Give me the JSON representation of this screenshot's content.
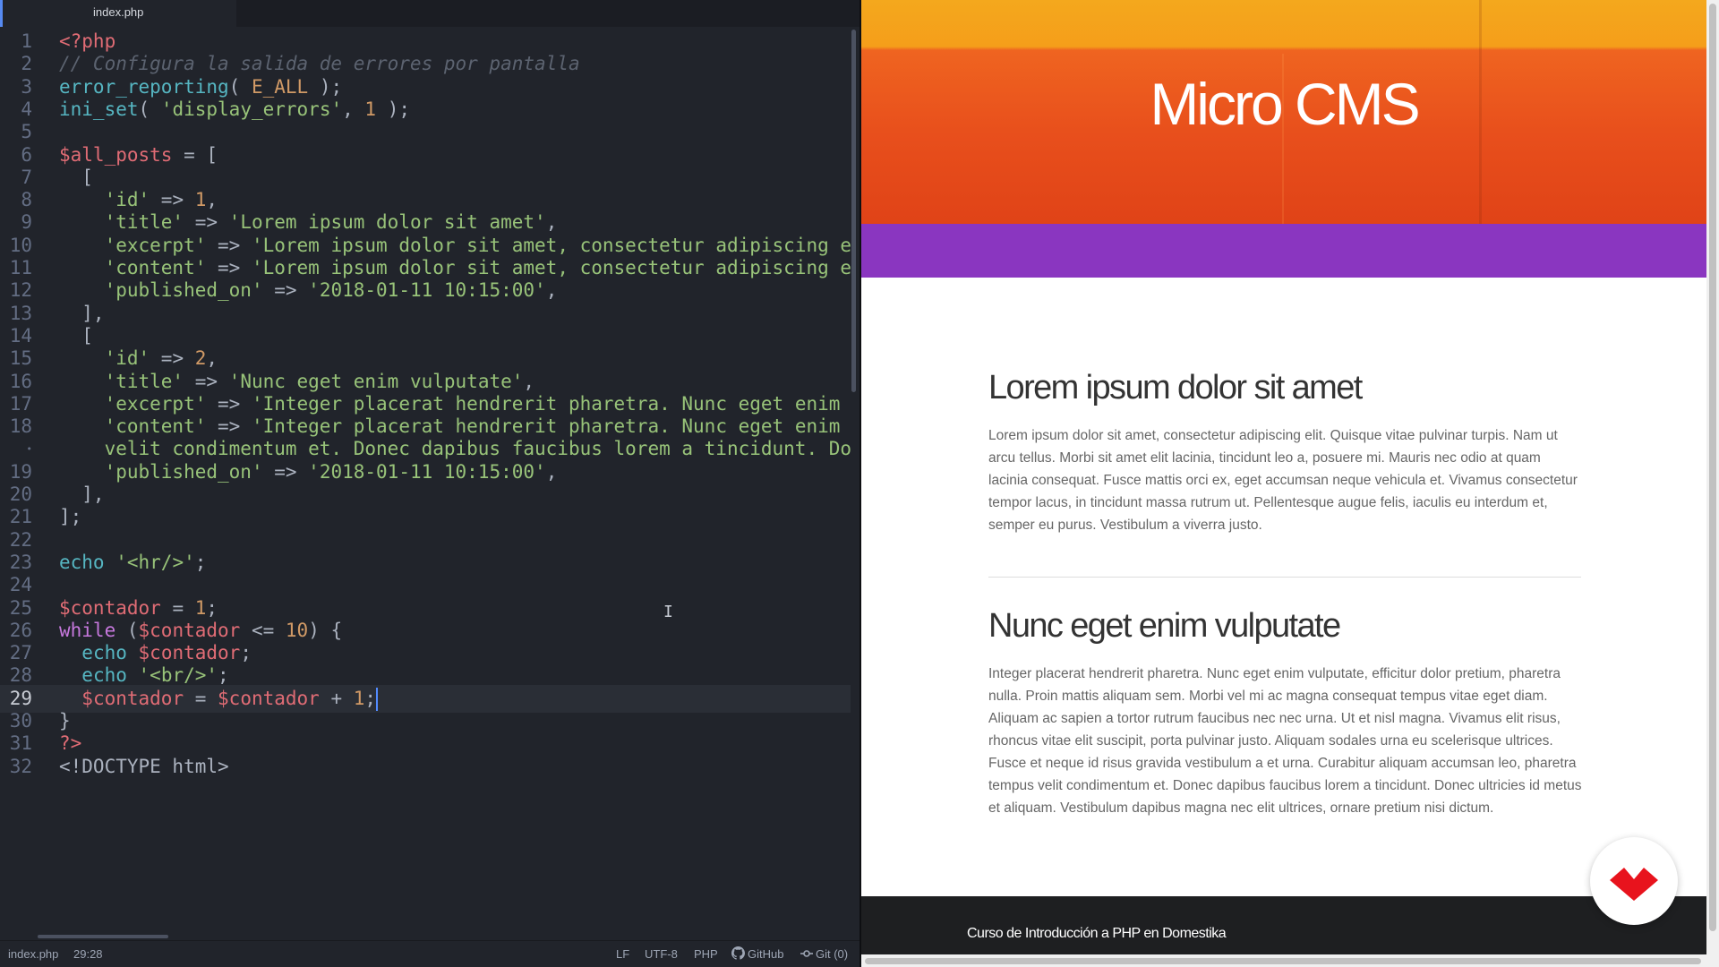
{
  "editor": {
    "tab_label": "index.php",
    "colors": {
      "keyword": "#c678dd",
      "function": "#56b6c2",
      "string": "#98c379",
      "number": "#d19a66",
      "variable": "#e06c75",
      "comment": "#5c6370",
      "punctuation": "#abb2bf"
    },
    "cursor_line": 29,
    "lines": [
      {
        "n": "1",
        "tokens": [
          [
            "<?php",
            "#e06c75"
          ]
        ]
      },
      {
        "n": "2",
        "tokens": [
          [
            "// Configura la salida de errores por pantalla",
            "#5c6370",
            "italic"
          ]
        ]
      },
      {
        "n": "3",
        "tokens": [
          [
            "error_reporting",
            "#56b6c2"
          ],
          [
            "( ",
            "#abb2bf"
          ],
          [
            "E_ALL",
            "#d19a66"
          ],
          [
            " );",
            "#abb2bf"
          ]
        ]
      },
      {
        "n": "4",
        "tokens": [
          [
            "ini_set",
            "#56b6c2"
          ],
          [
            "( ",
            "#abb2bf"
          ],
          [
            "'display_errors'",
            "#98c379"
          ],
          [
            ", ",
            "#abb2bf"
          ],
          [
            "1",
            "#d19a66"
          ],
          [
            " );",
            "#abb2bf"
          ]
        ]
      },
      {
        "n": "5",
        "tokens": []
      },
      {
        "n": "6",
        "tokens": [
          [
            "$all_posts",
            "#e06c75"
          ],
          [
            " = [",
            "#abb2bf"
          ]
        ]
      },
      {
        "n": "7",
        "tokens": [
          [
            "  [",
            "#abb2bf"
          ]
        ]
      },
      {
        "n": "8",
        "tokens": [
          [
            "    ",
            "#abb2bf"
          ],
          [
            "'id'",
            "#98c379"
          ],
          [
            " => ",
            "#abb2bf"
          ],
          [
            "1",
            "#d19a66"
          ],
          [
            ",",
            "#abb2bf"
          ]
        ]
      },
      {
        "n": "9",
        "tokens": [
          [
            "    ",
            "#abb2bf"
          ],
          [
            "'title'",
            "#98c379"
          ],
          [
            " => ",
            "#abb2bf"
          ],
          [
            "'Lorem ipsum dolor sit amet'",
            "#98c379"
          ],
          [
            ",",
            "#abb2bf"
          ]
        ]
      },
      {
        "n": "10",
        "tokens": [
          [
            "    ",
            "#abb2bf"
          ],
          [
            "'excerpt'",
            "#98c379"
          ],
          [
            " => ",
            "#abb2bf"
          ],
          [
            "'Lorem ipsum dolor sit amet, consectetur adipiscing e",
            "#98c379"
          ]
        ]
      },
      {
        "n": "11",
        "tokens": [
          [
            "    ",
            "#abb2bf"
          ],
          [
            "'content'",
            "#98c379"
          ],
          [
            " => ",
            "#abb2bf"
          ],
          [
            "'Lorem ipsum dolor sit amet, consectetur adipiscing e",
            "#98c379"
          ]
        ]
      },
      {
        "n": "12",
        "tokens": [
          [
            "    ",
            "#abb2bf"
          ],
          [
            "'published_on'",
            "#98c379"
          ],
          [
            " => ",
            "#abb2bf"
          ],
          [
            "'2018-01-11 10:15:00'",
            "#98c379"
          ],
          [
            ",",
            "#abb2bf"
          ]
        ]
      },
      {
        "n": "13",
        "tokens": [
          [
            "  ],",
            "#abb2bf"
          ]
        ]
      },
      {
        "n": "14",
        "tokens": [
          [
            "  [",
            "#abb2bf"
          ]
        ]
      },
      {
        "n": "15",
        "tokens": [
          [
            "    ",
            "#abb2bf"
          ],
          [
            "'id'",
            "#98c379"
          ],
          [
            " => ",
            "#abb2bf"
          ],
          [
            "2",
            "#d19a66"
          ],
          [
            ",",
            "#abb2bf"
          ]
        ]
      },
      {
        "n": "16",
        "tokens": [
          [
            "    ",
            "#abb2bf"
          ],
          [
            "'title'",
            "#98c379"
          ],
          [
            " => ",
            "#abb2bf"
          ],
          [
            "'Nunc eget enim vulputate'",
            "#98c379"
          ],
          [
            ",",
            "#abb2bf"
          ]
        ]
      },
      {
        "n": "17",
        "tokens": [
          [
            "    ",
            "#abb2bf"
          ],
          [
            "'excerpt'",
            "#98c379"
          ],
          [
            " => ",
            "#abb2bf"
          ],
          [
            "'Integer placerat hendrerit pharetra. Nunc eget enim",
            "#98c379"
          ]
        ]
      },
      {
        "n": "18",
        "tokens": [
          [
            "    ",
            "#abb2bf"
          ],
          [
            "'content'",
            "#98c379"
          ],
          [
            " => ",
            "#abb2bf"
          ],
          [
            "'Integer placerat hendrerit pharetra. Nunc eget enim",
            "#98c379"
          ]
        ]
      },
      {
        "n": "•",
        "tokens": [
          [
            "    velit condimentum et. Donec dapibus faucibus lorem a tincidunt. Do",
            "#98c379"
          ]
        ]
      },
      {
        "n": "19",
        "tokens": [
          [
            "    ",
            "#abb2bf"
          ],
          [
            "'published_on'",
            "#98c379"
          ],
          [
            " => ",
            "#abb2bf"
          ],
          [
            "'2018-01-11 10:15:00'",
            "#98c379"
          ],
          [
            ",",
            "#abb2bf"
          ]
        ]
      },
      {
        "n": "20",
        "tokens": [
          [
            "  ],",
            "#abb2bf"
          ]
        ]
      },
      {
        "n": "21",
        "tokens": [
          [
            "];",
            "#abb2bf"
          ]
        ]
      },
      {
        "n": "22",
        "tokens": []
      },
      {
        "n": "23",
        "tokens": [
          [
            "echo",
            "#56b6c2"
          ],
          [
            " ",
            "#abb2bf"
          ],
          [
            "'<hr/>'",
            "#98c379"
          ],
          [
            ";",
            "#abb2bf"
          ]
        ]
      },
      {
        "n": "24",
        "tokens": []
      },
      {
        "n": "25",
        "tokens": [
          [
            "$contador",
            "#e06c75"
          ],
          [
            " = ",
            "#abb2bf"
          ],
          [
            "1",
            "#d19a66"
          ],
          [
            ";",
            "#abb2bf"
          ]
        ]
      },
      {
        "n": "26",
        "tokens": [
          [
            "while",
            "#c678dd"
          ],
          [
            " (",
            "#abb2bf"
          ],
          [
            "$contador",
            "#e06c75"
          ],
          [
            " <= ",
            "#abb2bf"
          ],
          [
            "10",
            "#d19a66"
          ],
          [
            ") {",
            "#abb2bf"
          ]
        ]
      },
      {
        "n": "27",
        "tokens": [
          [
            "  ",
            "#abb2bf"
          ],
          [
            "echo",
            "#56b6c2"
          ],
          [
            " ",
            "#abb2bf"
          ],
          [
            "$contador",
            "#e06c75"
          ],
          [
            ";",
            "#abb2bf"
          ]
        ]
      },
      {
        "n": "28",
        "tokens": [
          [
            "  ",
            "#abb2bf"
          ],
          [
            "echo",
            "#56b6c2"
          ],
          [
            " ",
            "#abb2bf"
          ],
          [
            "'<br/>'",
            "#98c379"
          ],
          [
            ";",
            "#abb2bf"
          ]
        ]
      },
      {
        "n": "29",
        "tokens": [
          [
            "  ",
            "#abb2bf"
          ],
          [
            "$contador",
            "#e06c75"
          ],
          [
            " = ",
            "#abb2bf"
          ],
          [
            "$contador",
            "#e06c75"
          ],
          [
            " + ",
            "#abb2bf"
          ],
          [
            "1",
            "#d19a66"
          ],
          [
            ";",
            "#abb2bf"
          ]
        ]
      },
      {
        "n": "30",
        "tokens": [
          [
            "}",
            "#abb2bf"
          ]
        ]
      },
      {
        "n": "31",
        "tokens": [
          [
            "?>",
            "#e06c75"
          ]
        ]
      },
      {
        "n": "32",
        "tokens": [
          [
            "<!DOCTYPE html>",
            "#abb2bf"
          ]
        ]
      }
    ]
  },
  "statusbar": {
    "file": "index.php",
    "position": "29:28",
    "line_ending": "LF",
    "encoding": "UTF-8",
    "grammar": "PHP",
    "github": "GitHub",
    "git": "Git (0)"
  },
  "site": {
    "title": "Micro CMS",
    "posts": [
      {
        "title": "Lorem ipsum dolor sit amet",
        "body": "Lorem ipsum dolor sit amet, consectetur adipiscing elit. Quisque vitae pulvinar turpis. Nam ut arcu tellus. Morbi sit amet elit lacinia, tincidunt leo a, posuere mi. Mauris nec odio at quam lacinia consequat. Fusce mattis orci ex, eget accumsan neque vehicula et. Vivamus consectetur tempor lacus, in tincidunt massa rutrum ut. Pellentesque augue felis, iaculis eu interdum et, semper eu purus. Vestibulum a viverra justo."
      },
      {
        "title": "Nunc eget enim vulputate",
        "body": "Integer placerat hendrerit pharetra. Nunc eget enim vulputate, efficitur dolor pretium, pharetra nulla. Proin mattis aliquam sem. Morbi vel mi ac magna consequat tempus vitae eget diam. Aliquam ac sapien a tortor rutrum faucibus nec nec urna. Ut et nisl magna. Vivamus elit risus, rhoncus vitae elit suscipit, porta pulvinar justo. Aliquam sodales urna eu scelerisque ultrices. Fusce et neque id risus gravida vestibulum a et urna. Curabitur aliquam accumsan leo, pharetra tempus velit condimentum et. Donec dapibus faucibus lorem a tincidunt. Donec ultricies id metus et aliquam. Vestibulum dapibus magna nec elit ultrices, ornare pretium nisi dictum."
      }
    ],
    "footer_text": "Curso de Introducción a PHP en Domestika",
    "colors": {
      "hero_orange": "#e84f1c",
      "hero_yellow": "#f4a81d",
      "purple_band": "#8a36c0",
      "footer_bg": "#1e1f21",
      "logo_red": "#e8131d"
    },
    "badge_icon": "domestika-logo-icon"
  }
}
